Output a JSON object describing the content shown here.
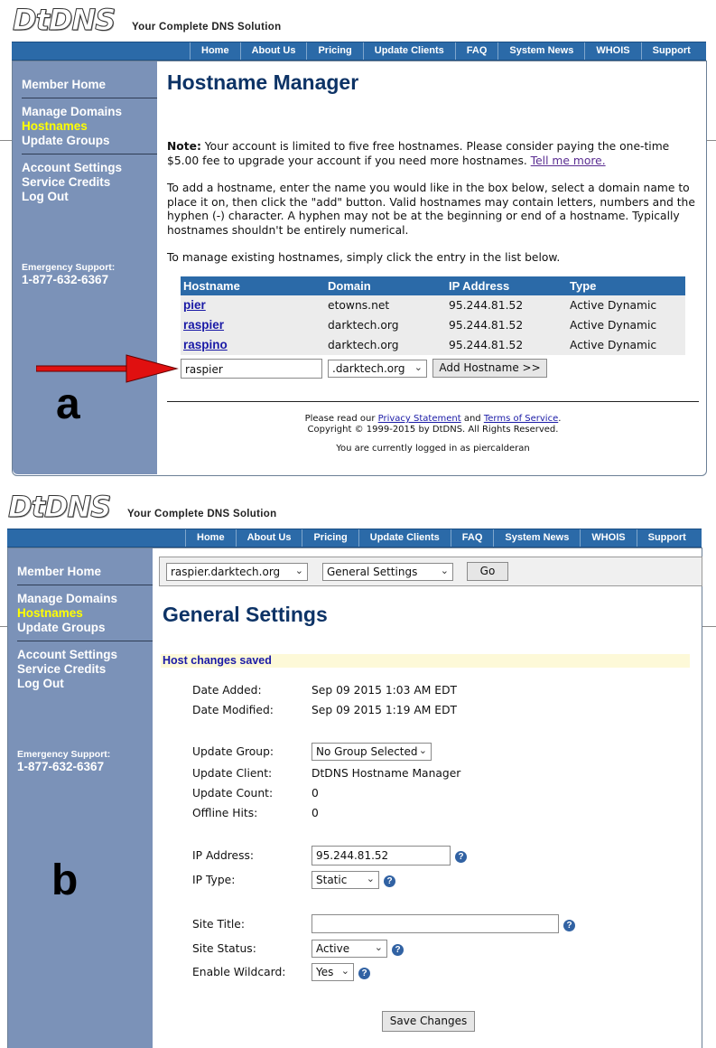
{
  "brand": {
    "logo": "DtDNS",
    "tagline": "Your Complete DNS Solution"
  },
  "nav": [
    "Home",
    "About Us",
    "Pricing",
    "Update Clients",
    "FAQ",
    "System News",
    "WHOIS",
    "Support"
  ],
  "sidebar": {
    "member_home": "Member Home",
    "manage_domains": "Manage Domains",
    "hostnames": "Hostnames",
    "update_groups": "Update Groups",
    "account_settings": "Account Settings",
    "service_credits": "Service Credits",
    "log_out": "Log Out",
    "emergency_label": "Emergency Support:",
    "emergency_phone": "1-877-632-6367"
  },
  "panel_a": {
    "letter": "a",
    "title": "Hostname Manager",
    "note_label": "Note:",
    "note_text": " Your account is limited to five free hostnames. Please consider paying the one-time $5.00 fee to upgrade your account if you need more hostnames. ",
    "note_link": "Tell me more.",
    "add_text": "To add a hostname, enter the name you would like in the box below, select a domain name to place it on, then click the \"add\" button. Valid hostnames may contain letters, numbers and the hyphen (-) character. A hyphen may not be at the beginning or end of a hostname. Typically hostnames shouldn't be entirely numerical.",
    "manage_text": "To manage existing hostnames, simply click the entry in the list below.",
    "table": {
      "headers": [
        "Hostname",
        "Domain",
        "IP Address",
        "Type"
      ],
      "rows": [
        [
          "pier",
          "etowns.net",
          "95.244.81.52",
          "Active Dynamic"
        ],
        [
          "raspier",
          "darktech.org",
          "95.244.81.52",
          "Active Dynamic"
        ],
        [
          "raspino",
          "darktech.org",
          "95.244.81.52",
          "Active Dynamic"
        ]
      ]
    },
    "hostname_input": "raspier",
    "domain_select": ".darktech.org",
    "add_button": "Add Hostname >>",
    "footer_prefix": "Please read our ",
    "privacy_link": "Privacy Statement",
    "footer_and": " and ",
    "terms_link": "Terms of Service",
    "footer_period": ".",
    "copyright": "Copyright © 1999-2015 by DtDNS. All Rights Reserved.",
    "logged_in": "You are currently logged in as piercalderan"
  },
  "panel_b": {
    "letter": "b",
    "host_select": "raspier.darktech.org",
    "settings_select": "General Settings",
    "go_button": "Go",
    "title": "General Settings",
    "saved_msg": "Host changes saved",
    "date_added_label": "Date Added:",
    "date_added": "Sep 09 2015 1:03 AM EDT",
    "date_modified_label": "Date Modified:",
    "date_modified": "Sep 09 2015 1:19 AM EDT",
    "update_group_label": "Update Group:",
    "update_group": "No Group Selected",
    "update_client_label": "Update Client:",
    "update_client": "DtDNS Hostname Manager",
    "update_count_label": "Update Count:",
    "update_count": "0",
    "offline_hits_label": "Offline Hits:",
    "offline_hits": "0",
    "ip_address_label": "IP Address:",
    "ip_address": "95.244.81.52",
    "ip_type_label": "IP Type:",
    "ip_type": "Static",
    "site_title_label": "Site Title:",
    "site_title": "",
    "site_status_label": "Site Status:",
    "site_status": "Active",
    "wildcard_label": "Enable Wildcard:",
    "wildcard": "Yes",
    "save_button": "Save Changes",
    "help_glyph": "?"
  },
  "colors": {
    "nav_blue": "#2b6aa8",
    "sidebar": "#7b92b8",
    "title": "#0d3366",
    "active_link": "#ffff00",
    "arrow": "#e01010"
  }
}
